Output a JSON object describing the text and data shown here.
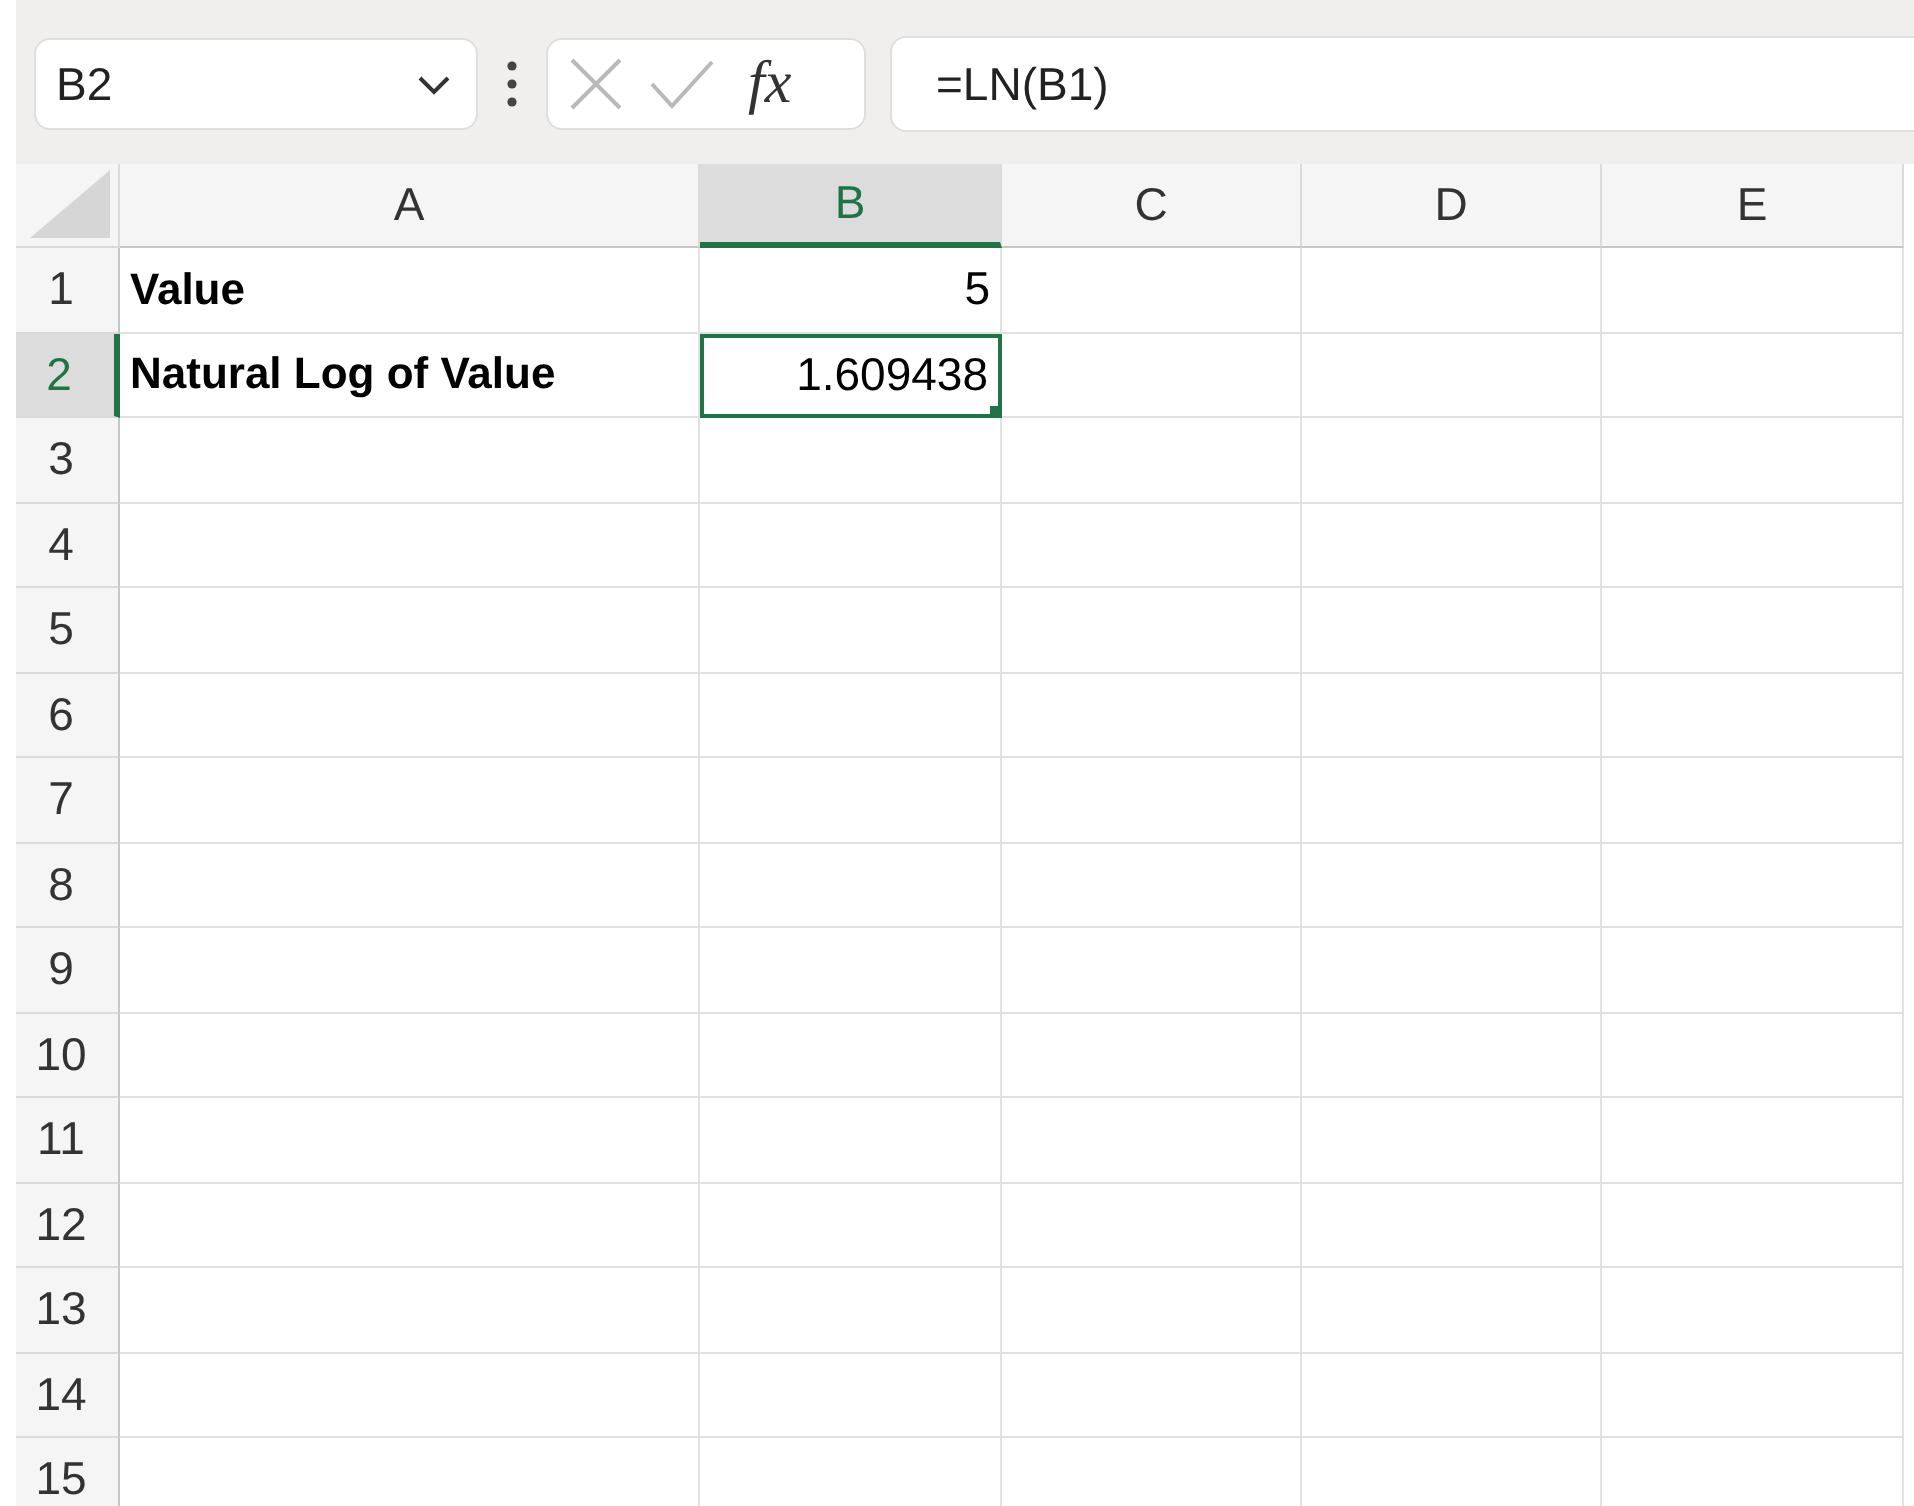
{
  "formula_bar": {
    "name_box": "B2",
    "fx_label": "fx",
    "formula": "=LN(B1)"
  },
  "columns": [
    {
      "label": "A",
      "selected": false
    },
    {
      "label": "B",
      "selected": true
    },
    {
      "label": "C",
      "selected": false
    },
    {
      "label": "D",
      "selected": false
    },
    {
      "label": "E",
      "selected": false
    }
  ],
  "rows": [
    {
      "label": "1",
      "selected": false,
      "cells": [
        {
          "kind": "text",
          "text": "Value",
          "bold": true,
          "selected": false
        },
        {
          "kind": "number",
          "text": "5",
          "bold": false,
          "selected": false
        }
      ]
    },
    {
      "label": "2",
      "selected": true,
      "cells": [
        {
          "kind": "text",
          "text": "Natural Log of Value",
          "bold": true,
          "selected": false
        },
        {
          "kind": "number",
          "text": "1.609438",
          "bold": false,
          "selected": true
        }
      ]
    },
    {
      "label": "3",
      "selected": false,
      "cells": []
    },
    {
      "label": "4",
      "selected": false,
      "cells": []
    },
    {
      "label": "5",
      "selected": false,
      "cells": []
    },
    {
      "label": "6",
      "selected": false,
      "cells": []
    },
    {
      "label": "7",
      "selected": false,
      "cells": []
    },
    {
      "label": "8",
      "selected": false,
      "cells": []
    },
    {
      "label": "9",
      "selected": false,
      "cells": []
    },
    {
      "label": "10",
      "selected": false,
      "cells": []
    },
    {
      "label": "11",
      "selected": false,
      "cells": []
    },
    {
      "label": "12",
      "selected": false,
      "cells": []
    },
    {
      "label": "13",
      "selected": false,
      "cells": []
    },
    {
      "label": "14",
      "selected": false,
      "cells": []
    },
    {
      "label": "15",
      "selected": false,
      "cells": []
    }
  ]
}
